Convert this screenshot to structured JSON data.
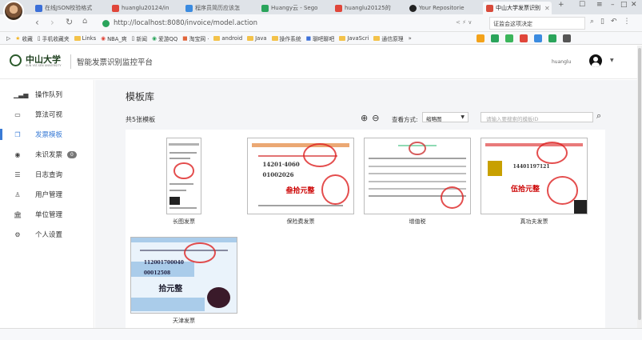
{
  "browser": {
    "tabs": [
      {
        "label": "在线JSON校验格式",
        "color": "#3b6fd8"
      },
      {
        "label": "huanglu20124/in",
        "color": "#e0463a"
      },
      {
        "label": "程序员简历应该怎",
        "color": "#3b8be0"
      },
      {
        "label": "Huangy云 - Sego",
        "color": "#2aa45b"
      },
      {
        "label": "huanglu20125的",
        "color": "#e0463a"
      },
      {
        "label": "Your Repositorie",
        "color": "#222222"
      },
      {
        "label": "中山大学发票识别",
        "color": "#d84a3a"
      }
    ],
    "url": "http://localhost:8080/invoice/model.action",
    "search_text": "证监会这项决定",
    "bookmarks": [
      {
        "label": "收藏",
        "type": "star"
      },
      {
        "label": "手机收藏夹",
        "type": "page"
      },
      {
        "label": "Links",
        "type": "folder"
      },
      {
        "label": "NBA_爽",
        "type": "page"
      },
      {
        "label": "新闻",
        "type": "page"
      },
      {
        "label": "爱游QQ",
        "type": "page"
      },
      {
        "label": "淘宝网 ·",
        "type": "page"
      },
      {
        "label": "android",
        "type": "folder"
      },
      {
        "label": "Java",
        "type": "folder"
      },
      {
        "label": "操作系统",
        "type": "folder"
      },
      {
        "label": "聊吧聊吧",
        "type": "page"
      },
      {
        "label": "JavaScri",
        "type": "folder"
      },
      {
        "label": "通信原理",
        "type": "folder"
      }
    ]
  },
  "app": {
    "logo_text": "中山大学",
    "logo_sub": "SUN YAT-SEN UNIVERSITY",
    "title": "智能发票识别监控平台",
    "user_name": "huanglu",
    "accent": "#3a7bd5"
  },
  "sidebar": {
    "items": [
      {
        "label": "操作队列",
        "icon": "bar-chart-icon"
      },
      {
        "label": "算法可视",
        "icon": "monitor-icon"
      },
      {
        "label": "发票模板",
        "icon": "template-icon",
        "active": true
      },
      {
        "label": "未识发票",
        "icon": "target-icon",
        "badge": "0"
      },
      {
        "label": "日志查询",
        "icon": "log-icon"
      },
      {
        "label": "用户管理",
        "icon": "user-icon"
      },
      {
        "label": "单位管理",
        "icon": "bank-icon"
      },
      {
        "label": "个人设置",
        "icon": "gear-icon"
      }
    ]
  },
  "main": {
    "heading": "模板库",
    "count_text": "共5张模板",
    "view_label": "查看方式:",
    "view_value": "缩略图",
    "search_placeholder": "请输入要搜索的模板ID",
    "templates": [
      {
        "label": "长图发票"
      },
      {
        "label": "保险费发票"
      },
      {
        "label": "增值税"
      },
      {
        "label": "真功夫发票"
      },
      {
        "label": "天津发票"
      }
    ]
  }
}
